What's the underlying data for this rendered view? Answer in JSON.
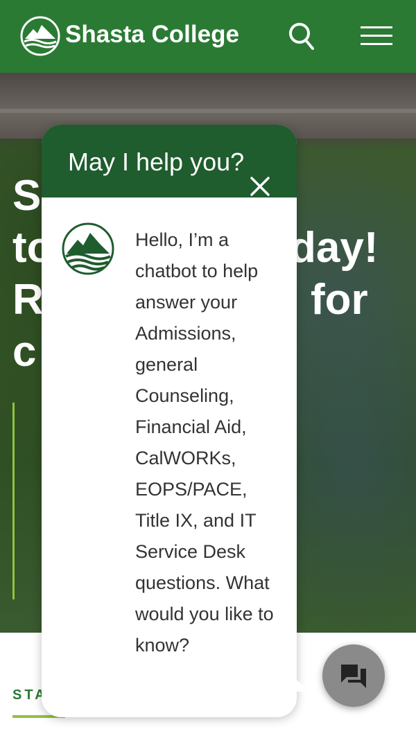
{
  "header": {
    "brand_name": "Shasta College",
    "logo_icon": "mountain-logo-icon",
    "search_icon": "search-icon",
    "menu_icon": "hamburger-menu-icon",
    "color": "#2a7a34"
  },
  "hero": {
    "lines": [
      "S",
      "to",
      "day!",
      "R",
      "for",
      "c"
    ]
  },
  "section": {
    "tab_label": "STA",
    "accent": "#8fc43d"
  },
  "chat": {
    "title": "May I help you?",
    "close_icon": "close-icon",
    "avatar_icon": "shasta-college-logo-icon",
    "message": "Hello, I’m a chatbot to help answer your Admissions, general Counseling, Financial Aid, CalWORKs, EOPS/PACE, Title IX, and IT Service Desk questions. What would you like to know?",
    "header_color": "#1f5c2e"
  },
  "fab": {
    "icon": "chat-bubbles-icon"
  }
}
